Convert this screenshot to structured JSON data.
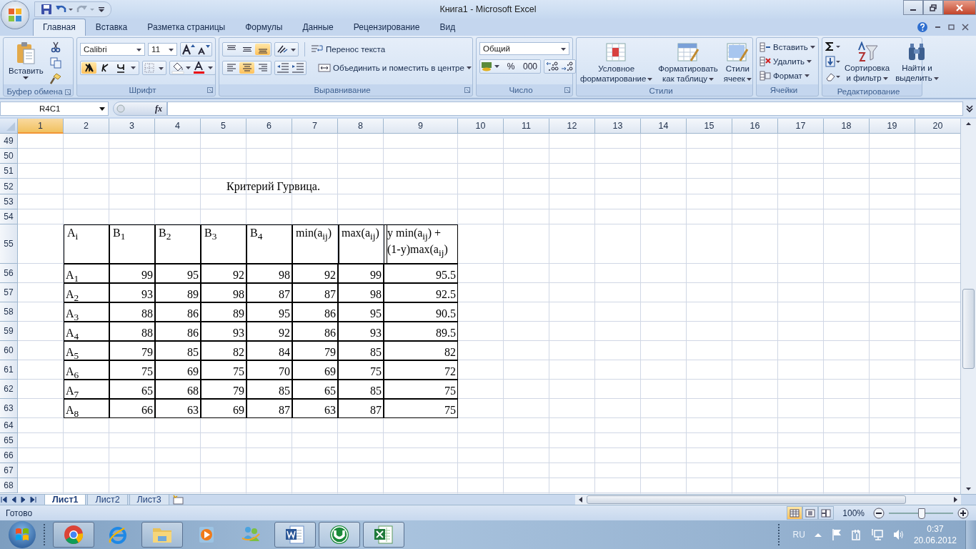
{
  "window": {
    "title": "Книга1 - Microsoft Excel"
  },
  "tabs": [
    {
      "label": "Главная",
      "selected": true
    },
    {
      "label": "Вставка",
      "selected": false
    },
    {
      "label": "Разметка страницы",
      "selected": false
    },
    {
      "label": "Формулы",
      "selected": false
    },
    {
      "label": "Данные",
      "selected": false
    },
    {
      "label": "Рецензирование",
      "selected": false
    },
    {
      "label": "Вид",
      "selected": false
    }
  ],
  "ribbon": {
    "clipboard": {
      "label": "Буфер обмена",
      "paste": "Вставить"
    },
    "font": {
      "label": "Шрифт",
      "family": "Calibri",
      "size": "11",
      "bold": true,
      "italic": false,
      "underline": false
    },
    "alignment": {
      "label": "Выравнивание",
      "top": false,
      "middle": false,
      "bottom": true,
      "left": false,
      "center": true,
      "right": false,
      "wrap": "Перенос текста",
      "merge": "Объединить и поместить в центре"
    },
    "number": {
      "label": "Число",
      "format": "Общий",
      "percent": "%",
      "thousands": "000"
    },
    "styles": {
      "label": "Стили",
      "buttons": [
        [
          "Условное",
          "форматирование"
        ],
        [
          "Форматировать",
          "как таблицу"
        ],
        [
          "Стили",
          "ячеек"
        ]
      ]
    },
    "cells": {
      "label": "Ячейки",
      "buttons": [
        "Вставить",
        "Удалить",
        "Формат"
      ]
    },
    "editing": {
      "label": "Редактирование",
      "sort": [
        "Сортировка",
        "и фильтр"
      ],
      "find": [
        "Найти и",
        "выделить"
      ]
    }
  },
  "formula_bar": {
    "name_box": "R4C1",
    "function_button": "fx"
  },
  "columns": [
    {
      "label": "1",
      "selected": true
    },
    {
      "label": "2",
      "selected": false
    },
    {
      "label": "3",
      "selected": false
    },
    {
      "label": "4",
      "selected": false
    },
    {
      "label": "5",
      "selected": false
    },
    {
      "label": "6",
      "selected": false
    },
    {
      "label": "7",
      "selected": false
    },
    {
      "label": "8",
      "selected": false
    },
    {
      "label": "9",
      "selected": false
    },
    {
      "label": "10",
      "selected": false
    },
    {
      "label": "11",
      "selected": false
    },
    {
      "label": "12",
      "selected": false
    },
    {
      "label": "13",
      "selected": false
    },
    {
      "label": "14",
      "selected": false
    },
    {
      "label": "15",
      "selected": false
    },
    {
      "label": "16",
      "selected": false
    },
    {
      "label": "17",
      "selected": false
    },
    {
      "label": "18",
      "selected": false
    },
    {
      "label": "19",
      "selected": false
    },
    {
      "label": "20",
      "selected": false
    }
  ],
  "rows": [
    {
      "number": "49",
      "kind": "blank"
    },
    {
      "number": "50",
      "kind": "blank"
    },
    {
      "number": "51",
      "kind": "blank"
    },
    {
      "number": "52",
      "kind": "title",
      "text": "Критерий Гурвица."
    },
    {
      "number": "53",
      "kind": "blank"
    },
    {
      "number": "54",
      "kind": "blank"
    },
    {
      "number": "55",
      "kind": "header",
      "cells": [
        "A$_{i}$",
        "B$_{1}$",
        "B$_{2}$",
        "B$_{3}$",
        "B$_{4}$",
        "min(a$_{ij}$)",
        "max(a$_{ij}$)",
        "y min(a$_{ij}$) + (1-y)max(a$_{ij}$)"
      ]
    },
    {
      "number": "56",
      "kind": "data",
      "cells": [
        "A$_{1}$",
        "99",
        "95",
        "92",
        "98",
        "92",
        "99",
        "95.5"
      ]
    },
    {
      "number": "57",
      "kind": "data",
      "cells": [
        "A$_{2}$",
        "93",
        "89",
        "98",
        "87",
        "87",
        "98",
        "92.5"
      ]
    },
    {
      "number": "58",
      "kind": "data",
      "cells": [
        "A$_{3}$",
        "88",
        "86",
        "89",
        "95",
        "86",
        "95",
        "90.5"
      ]
    },
    {
      "number": "59",
      "kind": "data",
      "cells": [
        "A$_{4}$",
        "88",
        "86",
        "93",
        "92",
        "86",
        "93",
        "89.5"
      ]
    },
    {
      "number": "60",
      "kind": "data",
      "cells": [
        "A$_{5}$",
        "79",
        "85",
        "82",
        "84",
        "79",
        "85",
        "82"
      ]
    },
    {
      "number": "61",
      "kind": "data",
      "cells": [
        "A$_{6}$",
        "75",
        "69",
        "75",
        "70",
        "69",
        "75",
        "72"
      ]
    },
    {
      "number": "62",
      "kind": "data",
      "cells": [
        "A$_{7}$",
        "65",
        "68",
        "79",
        "85",
        "65",
        "85",
        "75"
      ]
    },
    {
      "number": "63",
      "kind": "data",
      "cells": [
        "A$_{8}$",
        "66",
        "63",
        "69",
        "87",
        "63",
        "87",
        "75"
      ]
    },
    {
      "number": "64",
      "kind": "blank"
    },
    {
      "number": "65",
      "kind": "blank"
    },
    {
      "number": "66",
      "kind": "blank"
    },
    {
      "number": "67",
      "kind": "blank"
    },
    {
      "number": "68",
      "kind": "blank"
    }
  ],
  "sheet_tabs": [
    {
      "label": "Лист1",
      "selected": true
    },
    {
      "label": "Лист2",
      "selected": false
    },
    {
      "label": "Лист3",
      "selected": false
    }
  ],
  "status_bar": {
    "text": "Готово",
    "views": [
      {
        "selected": true
      },
      {
        "selected": false
      },
      {
        "selected": false
      }
    ],
    "zoom": "100%",
    "zoom_slider": {
      "level": 0.5
    }
  },
  "taskbar": {
    "apps": [
      {
        "kind": "chrome",
        "running": true
      },
      {
        "kind": "ie",
        "running": false
      },
      {
        "kind": "folder",
        "running": true
      },
      {
        "kind": "media",
        "running": false
      },
      {
        "kind": "messenger",
        "running": false
      },
      {
        "kind": "word",
        "running": true
      },
      {
        "kind": "torrent",
        "running": true
      },
      {
        "kind": "excel",
        "running": true
      }
    ],
    "language": "RU",
    "time": "0:37",
    "date": "20.06.2012"
  }
}
